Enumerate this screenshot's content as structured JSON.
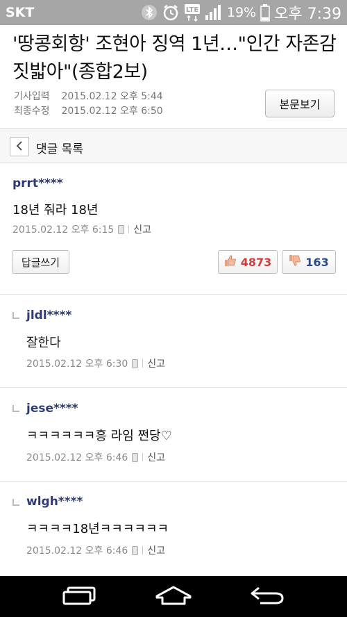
{
  "status_bar": {
    "carrier": "SKT",
    "network": "LTE",
    "battery": "19%",
    "time": "오후 7:39"
  },
  "article": {
    "title": "'땅콩회항' 조현아 징역 1년…\"인간 자존감 짓밟아\"(종합2보)",
    "published_label": "기사입력",
    "published": "2015.02.12 오후 5:44",
    "modified_label": "최종수정",
    "modified": "2015.02.12 오후 6:50",
    "view_body_button": "본문보기"
  },
  "comments_header": {
    "title": "댓글 목록"
  },
  "main_comment": {
    "author": "prrt****",
    "text": "18년 줘라 18년",
    "date": "2015.02.12 오후 6:15",
    "report": "신고",
    "reply_button": "답글쓰기",
    "likes": "4873",
    "dislikes": "163"
  },
  "replies": [
    {
      "author": "jldl****",
      "text": "잘한다",
      "date": "2015.02.12 오후 6:30",
      "report": "신고"
    },
    {
      "author": "jese****",
      "text": "ㅋㅋㅋㅋㅋㅋ흥 라임 쩐당♡",
      "date": "2015.02.12 오후 6:46",
      "report": "신고"
    },
    {
      "author": "wlgh****",
      "text": "ㅋㅋㅋㅋ18년ㅋㅋㅋㅋㅋㅋ",
      "date": "2015.02.12 오후 6:46",
      "report": "신고"
    }
  ],
  "colors": {
    "status_bar": "#a6a6a6",
    "author": "#2c3b78",
    "like": "#d63a3a",
    "dislike": "#2a4a8c"
  }
}
